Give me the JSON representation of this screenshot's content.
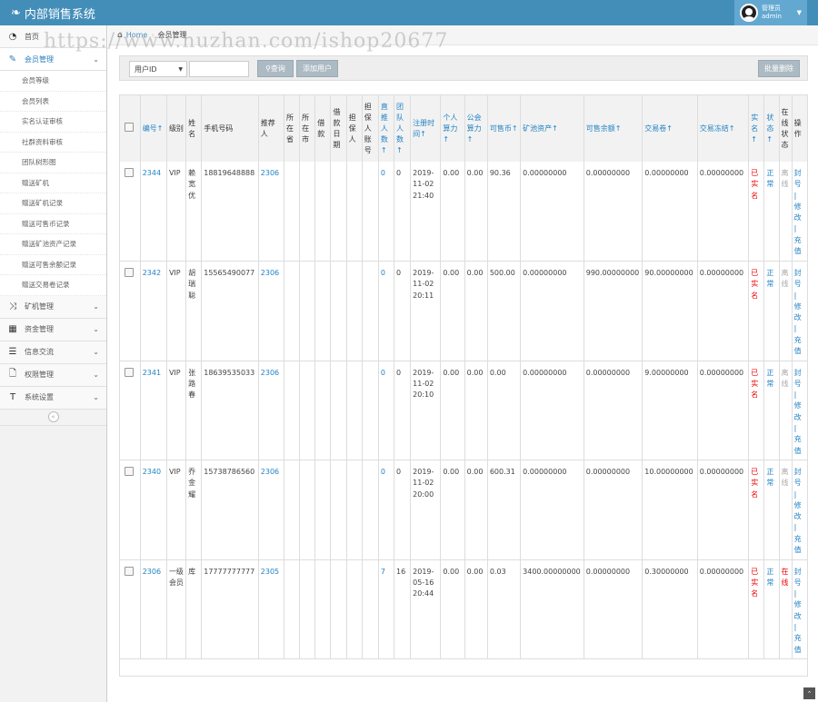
{
  "app": {
    "title": "内部销售系统",
    "user_role": "管理员",
    "user_name": "admin"
  },
  "watermark": "https://www.huzhan.com/ishop20677",
  "breadcrumb": {
    "home": "Home",
    "current": "会员管理"
  },
  "sidebar": {
    "top": [
      {
        "label": "首页",
        "icon": "dashboard-icon"
      },
      {
        "label": "会员管理",
        "icon": "edit-icon"
      }
    ],
    "sub": [
      "会员等级",
      "会员列表",
      "实名认证审核",
      "社群资料审核",
      "团队树形图",
      "赠送矿机",
      "赠送矿机记录",
      "赠送可售币记录",
      "赠送矿池资产记录",
      "赠送可售余额记录",
      "赠送交易卷记录"
    ],
    "bottom": [
      {
        "label": "矿机管理",
        "icon": "random-icon"
      },
      {
        "label": "资金管理",
        "icon": "calendar-icon"
      },
      {
        "label": "信息交流",
        "icon": "list-icon"
      },
      {
        "label": "权限管理",
        "icon": "file-icon"
      },
      {
        "label": "系统设置",
        "icon": "text-icon"
      }
    ]
  },
  "toolbar": {
    "select_value": "用户ID",
    "search_label": "查询",
    "add_label": "添加用户",
    "batch_delete_label": "批量删除"
  },
  "table": {
    "headers": [
      "编号↑",
      "级别",
      "姓名",
      "手机号码",
      "推荐人",
      "所在省",
      "所在市",
      "借款",
      "借款日期",
      "担保人",
      "担保人账号",
      "直推人数↑",
      "团队人数↑",
      "注册时间↑",
      "个人算力↑",
      "公会算力↑",
      "可售币↑",
      "矿池资产↑",
      "可售余额↑",
      "交易卷↑",
      "交易冻结↑",
      "实名↑",
      "状态↑",
      "在线状态",
      "操作"
    ],
    "rows": [
      {
        "id": "2344",
        "level": "VIP",
        "name": "赖宽优",
        "phone": "18819648888",
        "referrer": "2306",
        "province": "",
        "city": "",
        "loan": "",
        "loan_date": "",
        "guarantor": "",
        "guarantor_acct": "",
        "direct": "0",
        "team": "0",
        "reg_time": "2019-11-02 21:40",
        "personal": "0.00",
        "guild": "0.00",
        "coin": "90.36",
        "pool": "0.00000000",
        "balance": "0.00000000",
        "voucher": "0.00000000",
        "frozen": "0.00000000",
        "realname": "已实名",
        "status": "正常",
        "online": "离线",
        "ops": [
          "封号",
          "修改",
          "充值"
        ]
      },
      {
        "id": "2342",
        "level": "VIP",
        "name": "胡瑞聪",
        "phone": "15565490077",
        "referrer": "2306",
        "province": "",
        "city": "",
        "loan": "",
        "loan_date": "",
        "guarantor": "",
        "guarantor_acct": "",
        "direct": "0",
        "team": "0",
        "reg_time": "2019-11-02 20:11",
        "personal": "0.00",
        "guild": "0.00",
        "coin": "500.00",
        "pool": "0.00000000",
        "balance": "990.00000000",
        "voucher": "90.00000000",
        "frozen": "0.00000000",
        "realname": "已实名",
        "status": "正常",
        "online": "离线",
        "ops": [
          "封号",
          "修改",
          "充值"
        ]
      },
      {
        "id": "2341",
        "level": "VIP",
        "name": "张路春",
        "phone": "18639535033",
        "referrer": "2306",
        "province": "",
        "city": "",
        "loan": "",
        "loan_date": "",
        "guarantor": "",
        "guarantor_acct": "",
        "direct": "0",
        "team": "0",
        "reg_time": "2019-11-02 20:10",
        "personal": "0.00",
        "guild": "0.00",
        "coin": "0.00",
        "pool": "0.00000000",
        "balance": "0.00000000",
        "voucher": "9.00000000",
        "frozen": "0.00000000",
        "realname": "已实名",
        "status": "正常",
        "online": "离线",
        "ops": [
          "封号",
          "修改",
          "充值"
        ]
      },
      {
        "id": "2340",
        "level": "VIP",
        "name": "乔金耀",
        "phone": "15738786560",
        "referrer": "2306",
        "province": "",
        "city": "",
        "loan": "",
        "loan_date": "",
        "guarantor": "",
        "guarantor_acct": "",
        "direct": "0",
        "team": "0",
        "reg_time": "2019-11-02 20:00",
        "personal": "0.00",
        "guild": "0.00",
        "coin": "600.31",
        "pool": "0.00000000",
        "balance": "0.00000000",
        "voucher": "10.00000000",
        "frozen": "0.00000000",
        "realname": "已实名",
        "status": "正常",
        "online": "离线",
        "ops": [
          "封号",
          "修改",
          "充值"
        ]
      },
      {
        "id": "2306",
        "level": "一级会员",
        "name": "库",
        "phone": "17777777777",
        "referrer": "2305",
        "province": "",
        "city": "",
        "loan": "",
        "loan_date": "",
        "guarantor": "",
        "guarantor_acct": "",
        "direct": "7",
        "team": "16",
        "reg_time": "2019-05-16 20:44",
        "personal": "0.00",
        "guild": "0.00",
        "coin": "0.03",
        "pool": "3400.00000000",
        "balance": "0.00000000",
        "voucher": "0.30000000",
        "frozen": "0.00000000",
        "realname": "已实名",
        "status": "正常",
        "online": "在线",
        "ops": [
          "封号",
          "修改",
          "充值"
        ]
      }
    ]
  },
  "colors": {
    "topbar": "#438eb9",
    "link": "#2283c5",
    "realname": "#ee0000",
    "offline": "#aaaaaa",
    "online": "#ee0000"
  }
}
